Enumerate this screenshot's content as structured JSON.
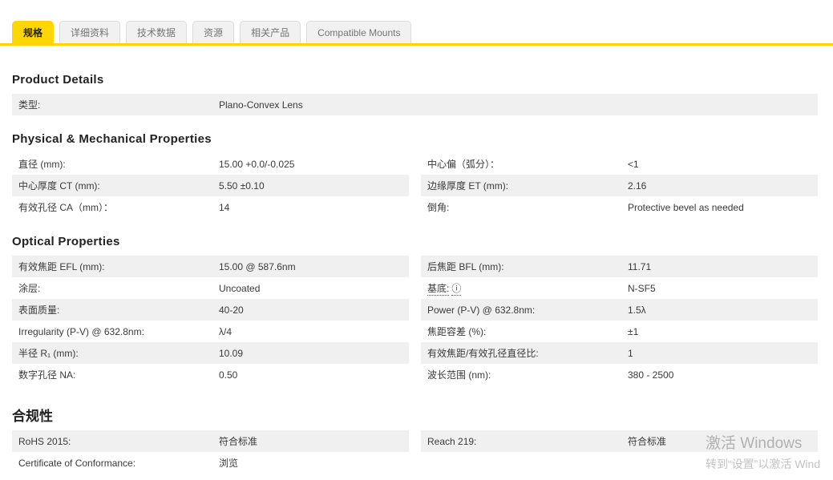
{
  "tabs": [
    {
      "label": "规格",
      "active": true
    },
    {
      "label": "详细资料",
      "active": false
    },
    {
      "label": "技术数据",
      "active": false
    },
    {
      "label": "资源",
      "active": false
    },
    {
      "label": "相关产品",
      "active": false
    },
    {
      "label": "Compatible Mounts",
      "active": false
    }
  ],
  "sections": [
    {
      "title": "Product Details",
      "stripe_start": "gray",
      "full_width": true,
      "columns": [
        [
          {
            "label": "类型:",
            "value": "Plano-Convex Lens"
          }
        ],
        []
      ]
    },
    {
      "title": "Physical & Mechanical Properties",
      "stripe_start": "white",
      "columns": [
        [
          {
            "label": "直径 (mm):",
            "value": "15.00 +0.0/-0.025"
          },
          {
            "label": "中心厚度 CT (mm):",
            "value": "5.50 ±0.10"
          },
          {
            "label": "有效孔径 CA（mm）：",
            "value": "14"
          }
        ],
        [
          {
            "label": "中心偏（弧分）：",
            "value": "<1"
          },
          {
            "label": "边缘厚度 ET (mm):",
            "value": "2.16"
          },
          {
            "label": "倒角:",
            "value": "Protective bevel as needed"
          }
        ]
      ]
    },
    {
      "title": "Optical Properties",
      "stripe_start": "gray",
      "columns": [
        [
          {
            "label": "有效焦距 EFL (mm):",
            "value": "15.00 @ 587.6nm"
          },
          {
            "label": "涂层:",
            "value": "Uncoated"
          },
          {
            "label": "表面质量:",
            "value": "40-20"
          },
          {
            "label": "Irregularity (P-V) @ 632.8nm:",
            "value": "λ/4"
          },
          {
            "label": "半径 R₁ (mm):",
            "value": "10.09"
          },
          {
            "label": "数字孔径 NA:",
            "value": "0.50"
          }
        ],
        [
          {
            "label": "后焦距 BFL (mm):",
            "value": "11.71"
          },
          {
            "label": "基底:",
            "value": "N-SF5",
            "link": true,
            "info": true
          },
          {
            "label": "Power (P-V) @ 632.8nm:",
            "value": "1.5λ"
          },
          {
            "label": "焦距容差 (%):",
            "value": "±1"
          },
          {
            "label": "有效焦距/有效孔径直径比:",
            "value": "1"
          },
          {
            "label": "波长范围 (nm):",
            "value": "380 - 2500"
          }
        ]
      ]
    },
    {
      "title": "合规性",
      "title_lang": "zh",
      "stripe_start": "gray",
      "columns": [
        [
          {
            "label": "RoHS 2015:",
            "value": "符合标准",
            "link": true
          },
          {
            "label": "Certificate of Conformance:",
            "value": "浏览",
            "link": true
          }
        ],
        [
          {
            "label": "Reach 219:",
            "value": "符合标准",
            "link": true
          }
        ]
      ]
    }
  ],
  "icons": {
    "info": "ⓘ"
  },
  "watermark": {
    "line1": "激活 Windows",
    "line2": "转到“设置”以激活 Wind"
  },
  "colors": {
    "accent_yellow": "#ffd600",
    "row_gray": "#f0f0f0",
    "link_blue": "#2e5fa8"
  }
}
